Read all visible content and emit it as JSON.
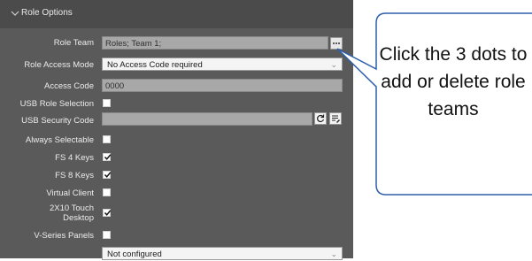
{
  "panel": {
    "title": "Role Options",
    "rows": [
      {
        "label": "Role Team",
        "value": "Roles; Team 1;"
      },
      {
        "label": "Role Access Mode",
        "value": "No Access Code required"
      },
      {
        "label": "Access Code",
        "value": "0000"
      },
      {
        "label": "USB Role Selection",
        "checked": false
      },
      {
        "label": "USB Security Code",
        "value": ""
      },
      {
        "label": "Always Selectable",
        "checked": false
      },
      {
        "label": "FS 4 Keys",
        "checked": true
      },
      {
        "label": "FS 8 Keys",
        "checked": true
      },
      {
        "label": "Virtual Client",
        "checked": false
      },
      {
        "label": "2X10 Touch Desktop",
        "checked": true
      },
      {
        "label": "V-Series Panels",
        "checked": false
      },
      {
        "label": "",
        "value": "Not configured"
      }
    ]
  },
  "callout": {
    "text": "Click the 3 dots to add or delete role teams"
  },
  "colors": {
    "panel_bg": "#5a5a5a",
    "callout_border": "#2e5fa8"
  },
  "icons": [
    "chevron-down-icon",
    "ellipsis-icon",
    "refresh-icon",
    "list-edit-icon",
    "checkmark-icon"
  ]
}
